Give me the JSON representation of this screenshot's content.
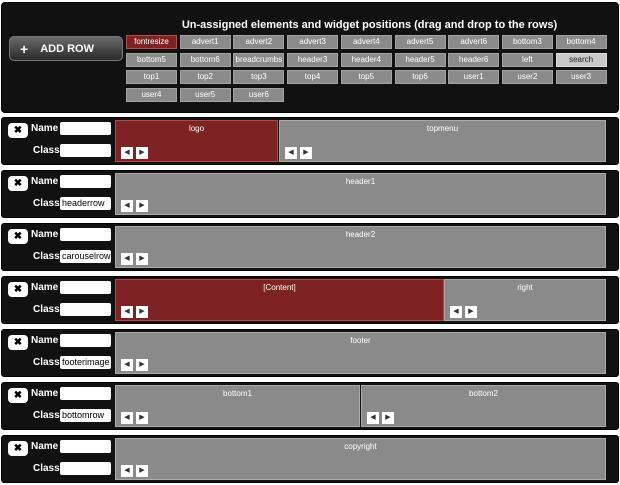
{
  "header": {
    "title": "Un-assigned elements and widget positions (drag and drop to the rows)",
    "add_row_label": "ADD ROW"
  },
  "chips": [
    "fontresize",
    "advert1",
    "advert2",
    "advert3",
    "advert4",
    "advert5",
    "advert6",
    "bottom3",
    "bottom4",
    "bottom5",
    "bottom6",
    "breadcrumbs",
    "header3",
    "header4",
    "header5",
    "header6",
    "left",
    "search",
    "top1",
    "top2",
    "top3",
    "top4",
    "top5",
    "top6",
    "user1",
    "user2",
    "user3",
    "user4",
    "user5",
    "user6"
  ],
  "labels": {
    "name": "Name",
    "class": "Class",
    "remove": "✖"
  },
  "arrows": {
    "left": "◀",
    "right": "▶"
  },
  "rows": [
    {
      "name": "",
      "class": "",
      "positions": [
        {
          "label": "logo",
          "style": "red"
        },
        {
          "label": "topmenu",
          "style": "gray"
        }
      ]
    },
    {
      "name": "",
      "class": "headerrow",
      "positions": [
        {
          "label": "header1",
          "style": "gray"
        }
      ]
    },
    {
      "name": "",
      "class": "carouselrow",
      "positions": [
        {
          "label": "header2",
          "style": "gray"
        }
      ]
    },
    {
      "name": "",
      "class": "",
      "positions": [
        {
          "label": "[Content]",
          "style": "red"
        },
        {
          "label": "right",
          "style": "gray"
        }
      ]
    },
    {
      "name": "",
      "class": "footerimage",
      "positions": [
        {
          "label": "footer",
          "style": "gray"
        }
      ]
    },
    {
      "name": "",
      "class": "bottomrow",
      "positions": [
        {
          "label": "bottom1",
          "style": "gray"
        },
        {
          "label": "bottom2",
          "style": "gray"
        }
      ]
    },
    {
      "name": "",
      "class": "",
      "positions": [
        {
          "label": "copyright",
          "style": "gray"
        }
      ]
    }
  ]
}
